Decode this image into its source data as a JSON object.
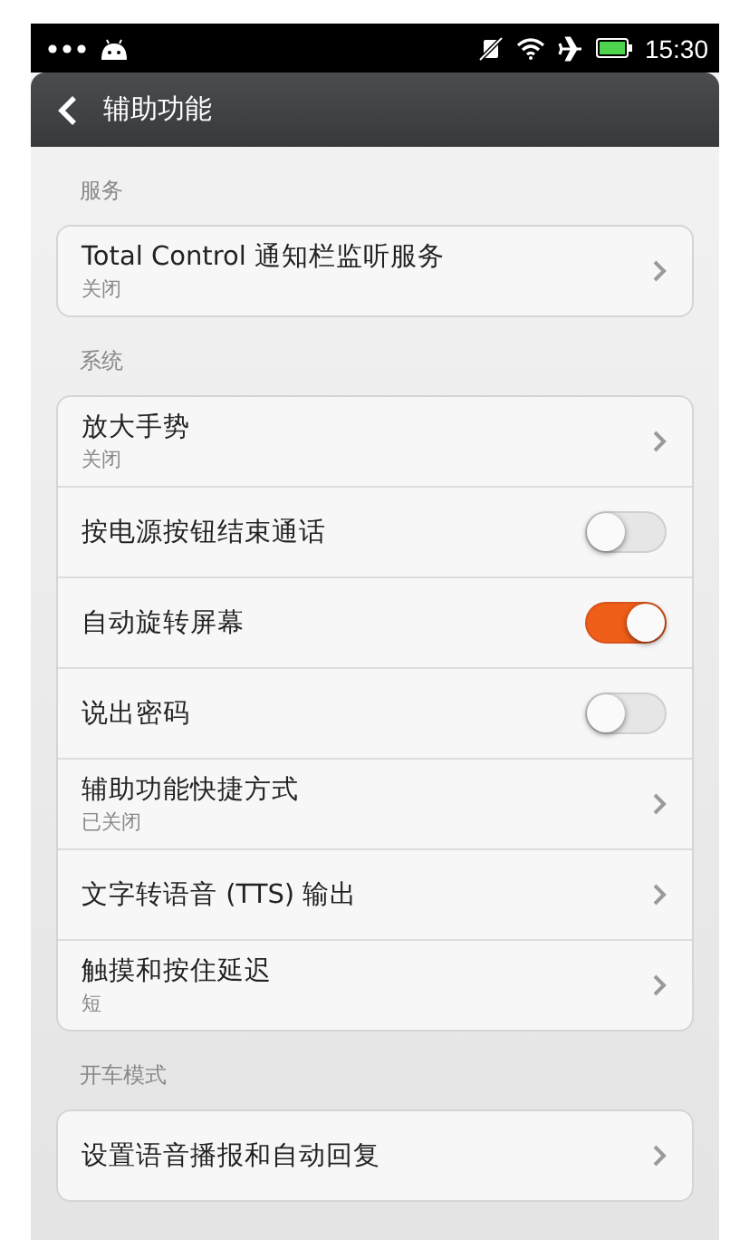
{
  "status_bar": {
    "time": "15:30"
  },
  "title_bar": {
    "title": "辅助功能"
  },
  "sections": [
    {
      "header": "服务",
      "items": [
        {
          "kind": "chevron",
          "title": "Total Control 通知栏监听服务",
          "subtitle": "关闭"
        }
      ]
    },
    {
      "header": "系统",
      "items": [
        {
          "kind": "chevron",
          "title": "放大手势",
          "subtitle": "关闭"
        },
        {
          "kind": "toggle",
          "title": "按电源按钮结束通话",
          "on": false
        },
        {
          "kind": "toggle",
          "title": "自动旋转屏幕",
          "on": true
        },
        {
          "kind": "toggle",
          "title": "说出密码",
          "on": false
        },
        {
          "kind": "chevron",
          "title": "辅助功能快捷方式",
          "subtitle": "已关闭"
        },
        {
          "kind": "chevron",
          "title": "文字转语音 (TTS) 输出"
        },
        {
          "kind": "chevron",
          "title": "触摸和按住延迟",
          "subtitle": "短"
        }
      ]
    },
    {
      "header": "开车模式",
      "items": [
        {
          "kind": "chevron",
          "title": "设置语音播报和自动回复"
        }
      ]
    }
  ]
}
